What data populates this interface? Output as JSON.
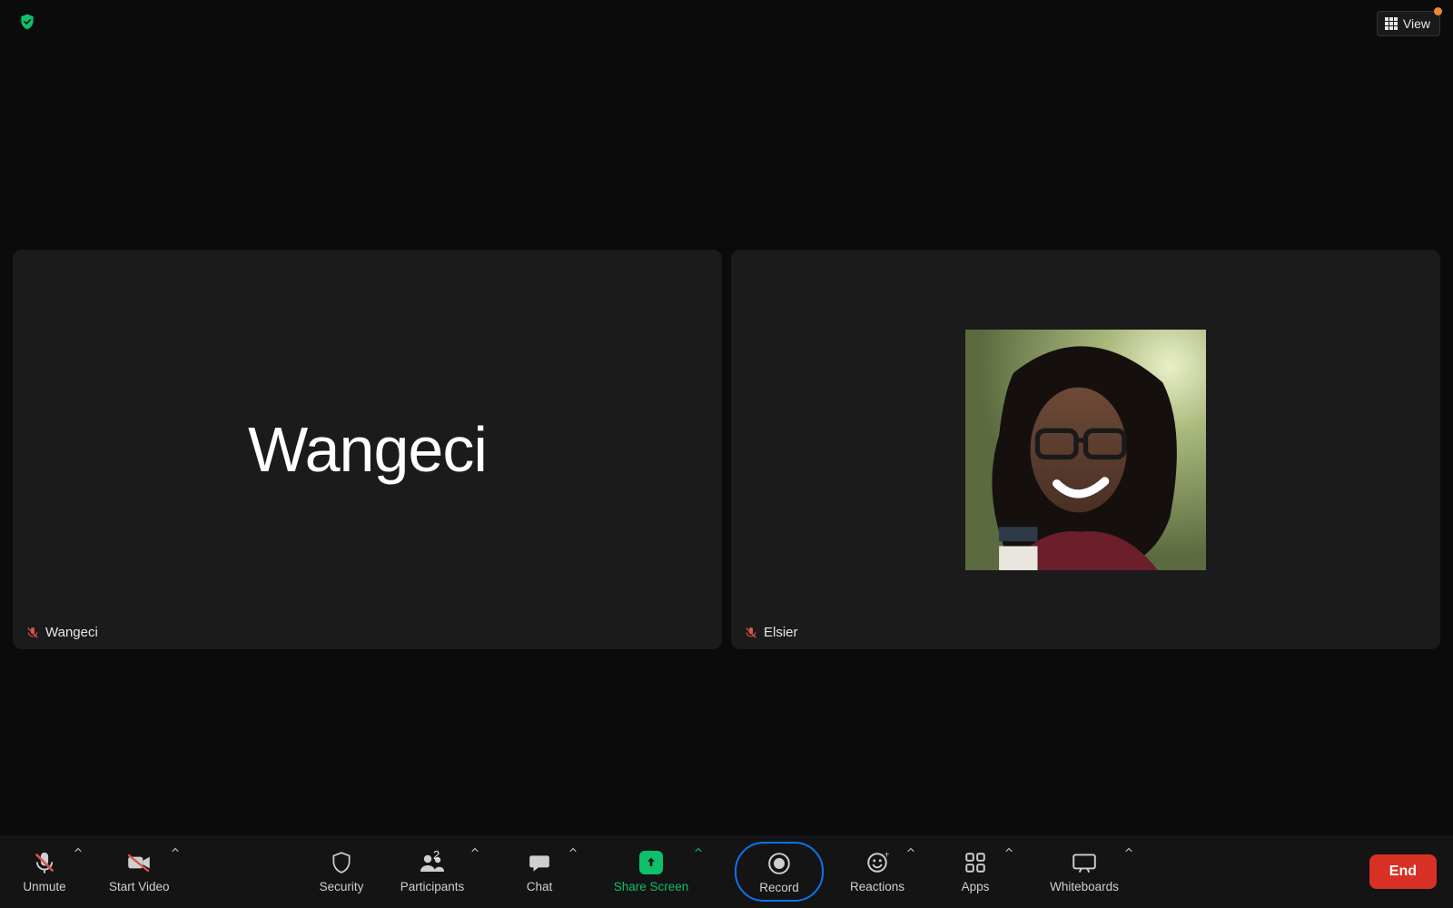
{
  "header": {
    "view_label": "View"
  },
  "tiles": [
    {
      "display_name": "Wangeci",
      "label_name": "Wangeci",
      "muted": true,
      "has_avatar": false
    },
    {
      "display_name": "",
      "label_name": "Elsier",
      "muted": true,
      "has_avatar": true
    }
  ],
  "toolbar": {
    "unmute": "Unmute",
    "start_video": "Start Video",
    "security": "Security",
    "participants": "Participants",
    "participants_count": "2",
    "chat": "Chat",
    "share_screen": "Share Screen",
    "record": "Record",
    "reactions": "Reactions",
    "apps": "Apps",
    "whiteboards": "Whiteboards",
    "end": "End"
  },
  "colors": {
    "accent_green": "#0dc06a",
    "accent_blue": "#0e72ed",
    "danger": "#d93025"
  }
}
